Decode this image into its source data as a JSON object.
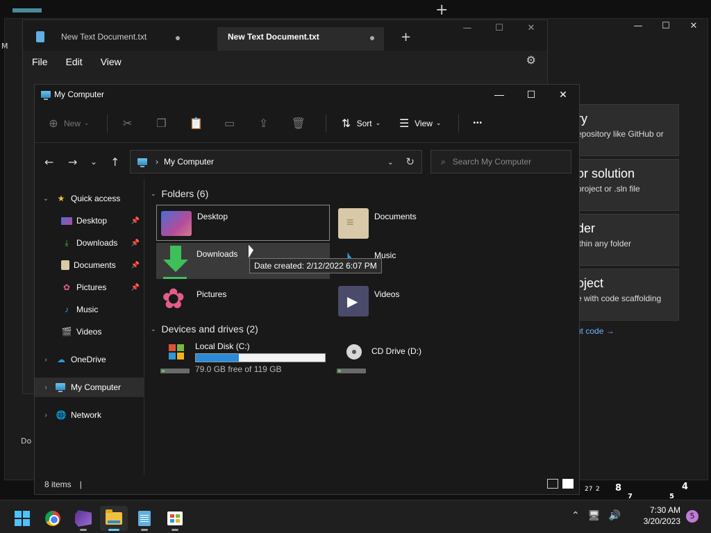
{
  "background": {
    "plus_glyph": "+",
    "m_text": "M",
    "do_text": "Do y",
    "vs_cards": [
      {
        "title": "ry",
        "subtitle": "epository like GitHub or"
      },
      {
        "title": "or solution",
        "subtitle": " project or .sln file"
      },
      {
        "title": "der",
        "subtitle": "ithin any folder"
      },
      {
        "title": "oject",
        "subtitle": "e with code scaffolding"
      }
    ],
    "vs_link": "ut code →",
    "clock_numbers": [
      "8",
      "4",
      "27",
      "2",
      "7",
      "5"
    ]
  },
  "notepad": {
    "tabs": [
      {
        "title": "New Text Document.txt",
        "active": false
      },
      {
        "title": "New Text Document.txt",
        "active": true
      }
    ],
    "new_tab_glyph": "+",
    "menu": [
      "File",
      "Edit",
      "View"
    ],
    "gear_glyph": "⚙"
  },
  "explorer": {
    "title": "My Computer",
    "toolbar": {
      "new_label": "New",
      "sort_label": "Sort",
      "view_label": "View",
      "more_glyph": "•••"
    },
    "address": {
      "path": "My Computer",
      "search_placeholder": "Search My Computer"
    },
    "nav": {
      "quick_access": "Quick access",
      "items": [
        {
          "label": "Desktop",
          "pinned": true
        },
        {
          "label": "Downloads",
          "pinned": true
        },
        {
          "label": "Documents",
          "pinned": true
        },
        {
          "label": "Pictures",
          "pinned": true
        },
        {
          "label": "Music",
          "pinned": false
        },
        {
          "label": "Videos",
          "pinned": false
        }
      ],
      "onedrive": "OneDrive",
      "my_computer": "My Computer",
      "network": "Network"
    },
    "folders_header": "Folders (6)",
    "folders": [
      {
        "name": "Desktop",
        "icon": "desktop-icon"
      },
      {
        "name": "Documents",
        "icon": "documents-icon"
      },
      {
        "name": "Downloads",
        "icon": "downloads-icon"
      },
      {
        "name": "Music",
        "icon": "music-icon"
      },
      {
        "name": "Pictures",
        "icon": "pictures-icon"
      },
      {
        "name": "Videos",
        "icon": "videos-icon"
      }
    ],
    "drives_header": "Devices and drives (2)",
    "drives": [
      {
        "name": "Local Disk (C:)",
        "free_text": "79.0 GB free of 119 GB",
        "used_fraction": 0.336
      },
      {
        "name": "CD Drive (D:)"
      }
    ],
    "tooltip": "Date created: 2/12/2022 6:07 PM",
    "status": {
      "items": "8 items",
      "cursor": "|"
    }
  },
  "taskbar": {
    "time": "7:30 AM",
    "date": "3/20/2023",
    "notification_count": "5",
    "apps": [
      "start",
      "chrome",
      "visual-studio",
      "file-explorer",
      "notepad",
      "store"
    ]
  },
  "colors": {
    "accent": "#60cdff",
    "drive_fill": "#2b8ad8"
  }
}
